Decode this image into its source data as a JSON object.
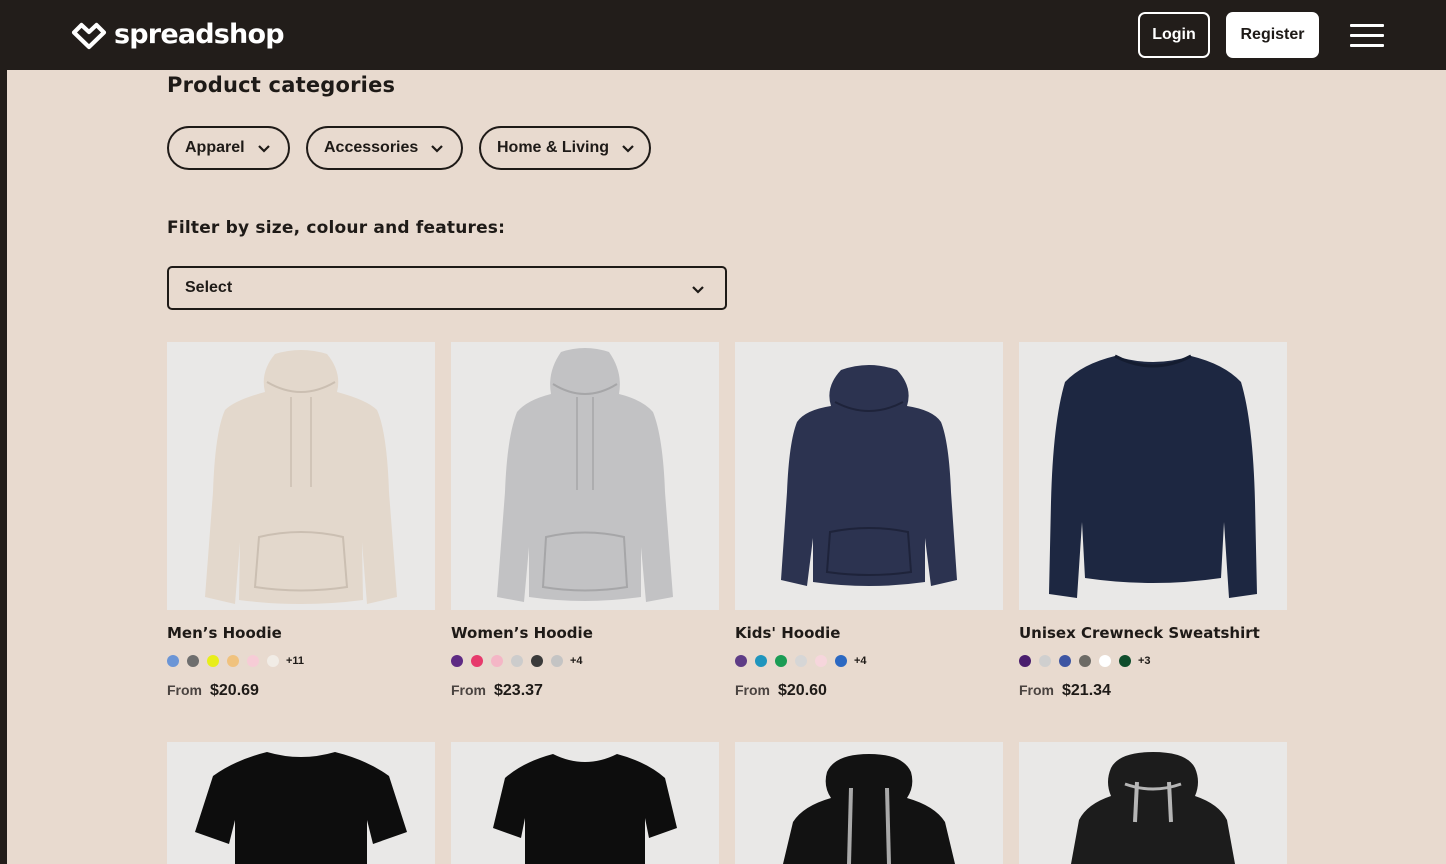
{
  "header": {
    "logo_text": "spreadshop",
    "login_label": "Login",
    "register_label": "Register",
    "menu_icon": "hamburger-menu-icon"
  },
  "categories": {
    "title": "Product categories",
    "items": [
      {
        "label": "Apparel"
      },
      {
        "label": "Accessories"
      },
      {
        "label": "Home & Living"
      }
    ]
  },
  "filter": {
    "title": "Filter by size, colour and features:",
    "select_value": "Select"
  },
  "products": [
    {
      "name": "Men’s Hoodie",
      "from_label": "From",
      "price": "$20.69",
      "swatches": [
        "#6b95d6",
        "#6e6e6e",
        "#e8ee1a",
        "#f0c27e",
        "#f6ccd6",
        "#f1ece6"
      ],
      "more": "+11",
      "color": "#e3d8cc"
    },
    {
      "name": "Women’s Hoodie",
      "from_label": "From",
      "price": "$23.37",
      "swatches": [
        "#5e2a84",
        "#e73a6c",
        "#f4b6c6",
        "#cccccc",
        "#3a3a3a",
        "#c4c4c4"
      ],
      "more": "+4",
      "color": "#c2c2c4"
    },
    {
      "name": "Kids' Hoodie",
      "from_label": "From",
      "price": "$20.60",
      "swatches": [
        "#5e3c86",
        "#1f95bd",
        "#1a9c55",
        "#d6d6d6",
        "#f6d6dc",
        "#2b68c2"
      ],
      "more": "+4",
      "color": "#2c3350"
    },
    {
      "name": "Unisex Crewneck Sweatshirt",
      "from_label": "From",
      "price": "$21.34",
      "swatches": [
        "#4a1e6e",
        "#cfcfcf",
        "#3d55a3",
        "#6d6b66",
        "#ffffff",
        "#0f4d2c"
      ],
      "more": "+3",
      "color": "#1d2741"
    },
    {
      "name": "",
      "color": "#0d0d0d"
    },
    {
      "name": "",
      "color": "#0d0d0d"
    },
    {
      "name": "",
      "color": "#121212"
    },
    {
      "name": "",
      "color": "#1c1c1c"
    }
  ]
}
